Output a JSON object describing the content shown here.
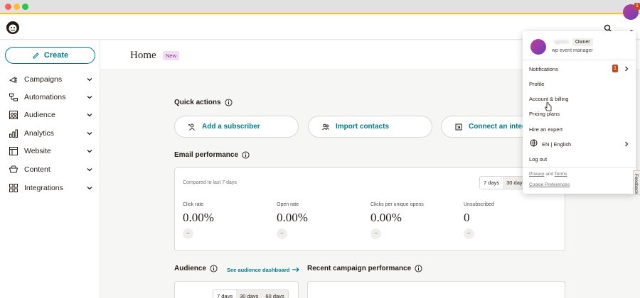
{
  "header": {
    "page_title": "Home",
    "new_badge": "New"
  },
  "sidebar": {
    "create_label": "Create",
    "items": [
      {
        "label": "Campaigns",
        "icon": "campaigns-icon"
      },
      {
        "label": "Automations",
        "icon": "automations-icon"
      },
      {
        "label": "Audience",
        "icon": "audience-icon"
      },
      {
        "label": "Analytics",
        "icon": "analytics-icon"
      },
      {
        "label": "Website",
        "icon": "website-icon"
      },
      {
        "label": "Content",
        "icon": "content-icon"
      },
      {
        "label": "Integrations",
        "icon": "integrations-icon"
      }
    ]
  },
  "quick_actions": {
    "title": "Quick actions",
    "buttons": [
      {
        "label": "Add a subscriber",
        "icon": "add-person-icon"
      },
      {
        "label": "Import contacts",
        "icon": "contacts-icon"
      },
      {
        "label": "Connect an integrati",
        "icon": "integration-icon"
      }
    ]
  },
  "email_performance": {
    "title": "Email performance",
    "compared": "Compared to last 7 days",
    "periods": [
      "7 days",
      "30 day"
    ],
    "metrics": [
      {
        "label": "Click rate",
        "value": "0.00%",
        "change": "--"
      },
      {
        "label": "Open rate",
        "value": "0.00%",
        "change": "--"
      },
      {
        "label": "Clicks per unique opens",
        "value": "0.00%",
        "change": "--"
      },
      {
        "label": "Unsubscribed",
        "value": "0",
        "change": "--"
      }
    ]
  },
  "audience": {
    "title": "Audience",
    "dashboard_link": "See audience dashboard",
    "periods": [
      "7 days",
      "30 days",
      "60 days"
    ]
  },
  "recent_campaign": {
    "title": "Recent campaign performance"
  },
  "top_badge": "1",
  "dropdown": {
    "user_name": "sgreen",
    "role": "Owner",
    "org": "wp event manager",
    "notifications_label": "Notifications",
    "notifications_count": "1",
    "profile": "Profile",
    "account_billing": "Account & billing",
    "pricing_plans": "Pricing plans",
    "hire_expert": "Hire an expert",
    "language": "EN | English",
    "logout": "Log out",
    "privacy": "Privacy",
    "and": "and",
    "terms": "Terms",
    "cookie": "Cookie Preferences"
  },
  "feedback": "Feedback",
  "colors": {
    "accent": "#007c89",
    "badge": "#c24a1c",
    "brand_yellow": "#ffc400"
  }
}
